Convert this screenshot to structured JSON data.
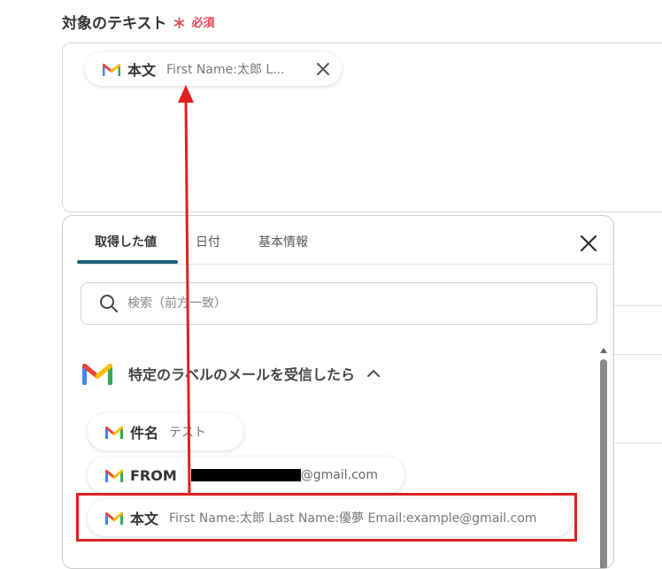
{
  "field": {
    "label": "対象のテキスト",
    "required_mark": "＊",
    "required_text": "必須"
  },
  "selected_chip": {
    "icon": "gmail-icon",
    "name": "本文",
    "value": "First Name:太郎 L..."
  },
  "panel": {
    "tabs": [
      {
        "label": "取得した値"
      },
      {
        "label": "日付"
      },
      {
        "label": "基本情報"
      }
    ],
    "search": {
      "placeholder": "検索（前方一致）",
      "value": ""
    },
    "section": {
      "title": "特定のラベルのメールを受信したら",
      "icon": "gmail-icon"
    },
    "items": [
      {
        "name": "件名",
        "value": "テスト"
      },
      {
        "name": "FROM",
        "value": "@gmail.com"
      },
      {
        "name": "本文",
        "value": "First Name:太郎 Last Name:優夢 Email:example@gmail.com"
      }
    ]
  },
  "colors": {
    "required": "#e0454d",
    "tab_accent": "#1e5e78",
    "annotation_red": "#e02020"
  }
}
